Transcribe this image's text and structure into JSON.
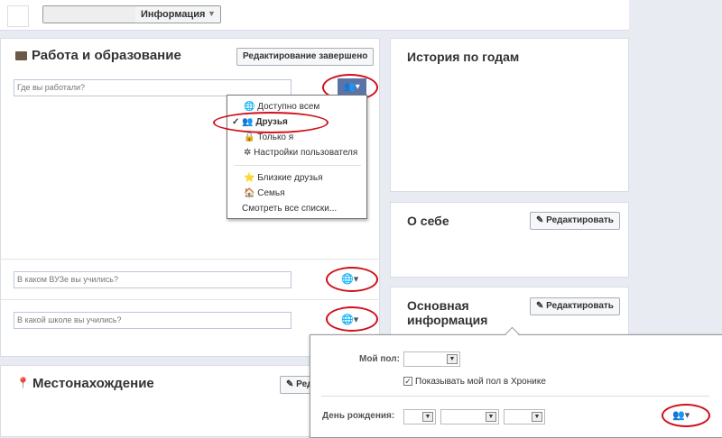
{
  "header": {
    "tab_label": "Информация"
  },
  "work": {
    "title": "Работа и образование",
    "done_button": "Редактирование завершено",
    "work_placeholder": "Где вы работали?",
    "university_placeholder": "В каком ВУЗе вы учились?",
    "school_placeholder": "В какой школе вы учились?"
  },
  "privacy_menu": {
    "items": [
      "Доступно всем",
      "Друзья",
      "Только я",
      "Настройки пользователя"
    ],
    "lists": [
      "Близкие друзья",
      "Семья"
    ],
    "see_all": "Смотреть все списки..."
  },
  "location": {
    "title": "Местонахождение",
    "edit_button": "Ред"
  },
  "history": {
    "title": "История по годам"
  },
  "about": {
    "title": "О себе",
    "edit_button": "Редактировать"
  },
  "basic": {
    "title_line1": "Основная",
    "title_line2": "информация",
    "edit_button": "Редактировать",
    "gender_label": "Мой пол:",
    "show_gender_label": "Показывать мой пол в Хронике",
    "birthday_label": "День рождения:"
  },
  "colors": {
    "accent": "#5b74a8",
    "highlight": "#d0101a"
  }
}
